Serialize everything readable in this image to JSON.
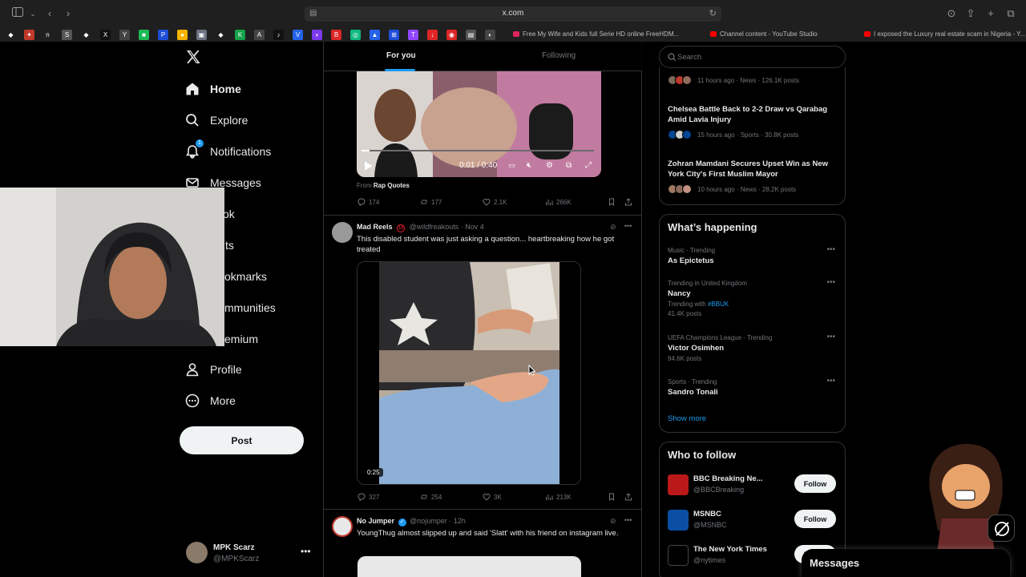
{
  "browser": {
    "url": "x.com",
    "tabs": [
      {
        "title": "Free My Wife and Kids full Serie HD online FreeHDM...",
        "color": "#e0245e"
      },
      {
        "title": "Channel content - YouTube Studio",
        "color": "#ff0000"
      },
      {
        "title": "I exposed the Luxury real estate scam in Nigeria - Y...",
        "color": "#ff0000"
      }
    ],
    "bookmark_icons": [
      {
        "glyph": "◆",
        "color": "#1f1f1f"
      },
      {
        "glyph": "✦",
        "color": "#c0392b"
      },
      {
        "glyph": "n",
        "color": "#1f1f1f"
      },
      {
        "glyph": "S",
        "color": "#555"
      },
      {
        "glyph": "◆",
        "color": "#1f1f1f"
      },
      {
        "glyph": "X",
        "color": "#111"
      },
      {
        "glyph": "Y",
        "color": "#444"
      },
      {
        "glyph": "■",
        "color": "#1db954"
      },
      {
        "glyph": "P",
        "color": "#1d4ed8"
      },
      {
        "glyph": "●",
        "color": "#f4b400"
      },
      {
        "glyph": "▣",
        "color": "#6b7280"
      },
      {
        "glyph": "◆",
        "color": "#1f1f1f"
      },
      {
        "glyph": "K",
        "color": "#16a34a"
      },
      {
        "glyph": "A",
        "color": "#444"
      },
      {
        "glyph": "♪",
        "color": "#111"
      },
      {
        "glyph": "V",
        "color": "#2563eb"
      },
      {
        "glyph": "◗",
        "color": "#7c3aed"
      },
      {
        "glyph": "B",
        "color": "#dc2626"
      },
      {
        "glyph": "◎",
        "color": "#10b981"
      },
      {
        "glyph": "▲",
        "color": "#2563eb"
      },
      {
        "glyph": "⊞",
        "color": "#1d4ed8"
      },
      {
        "glyph": "T",
        "color": "#9146ff"
      },
      {
        "glyph": "↓",
        "color": "#dc2626"
      },
      {
        "glyph": "◉",
        "color": "#dc2626"
      },
      {
        "glyph": "▤",
        "color": "#555"
      },
      {
        "glyph": "◐",
        "color": "#444"
      }
    ]
  },
  "nav": {
    "items": [
      {
        "label": "Home"
      },
      {
        "label": "Explore"
      },
      {
        "label": "Notifications",
        "badge": "1"
      },
      {
        "label": "Messages"
      },
      {
        "label": "ok"
      },
      {
        "label": "ts"
      },
      {
        "label": "okmarks"
      },
      {
        "label": "mmunities"
      },
      {
        "label": "emium"
      },
      {
        "label": "Profile"
      },
      {
        "label": "More"
      }
    ],
    "post_label": "Post",
    "account": {
      "name": "MPK Scarz",
      "handle": "@MPKScarz"
    }
  },
  "feed": {
    "tabs": [
      {
        "label": "For you"
      },
      {
        "label": "Following"
      }
    ],
    "video1": {
      "time": "0:01 / 0:40",
      "from_prefix": "From",
      "from_name": "Rap Quotes",
      "actions": {
        "replies": "174",
        "reposts": "177",
        "likes": "2.1K",
        "views": "266K"
      }
    },
    "tweet2": {
      "name": "Mad Reels",
      "age_badge": "18",
      "meta": "@wildfreakouts · Nov 4",
      "text": "This disabled student was just asking a question... heartbreaking how he got treated",
      "duration": "0:25",
      "actions": {
        "replies": "327",
        "reposts": "254",
        "likes": "3K",
        "views": "213K"
      }
    },
    "tweet3": {
      "name": "No Jumper",
      "meta": "@nojumper · 12h",
      "text": "YoungThug almost slipped up and said 'Slatt' with his friend on instagram live."
    }
  },
  "sidebar": {
    "search_placeholder": "Search",
    "news": [
      {
        "title": "",
        "meta": "11 hours ago · News · 126.1K posts"
      },
      {
        "title": "Chelsea Battle Back to 2-2 Draw vs Qarabag Amid Lavia Injury",
        "meta": "15 hours ago · Sports · 30.8K posts"
      },
      {
        "title": "Zohran Mamdani Secures Upset Win as New York City's First Muslim Mayor",
        "meta": "10 hours ago · News · 28.2K posts"
      }
    ],
    "whats_happening": {
      "title": "What’s happening",
      "trends": [
        {
          "context": "Music · Trending",
          "name": "As Epictetus",
          "sub": ""
        },
        {
          "context": "Trending in United Kingdom",
          "name": "Nancy",
          "sub_prefix": "Trending with",
          "sub_tag": "#BBUK",
          "posts": "41.4K posts"
        },
        {
          "context": "UEFA Champions League · Trending",
          "name": "Victor Osimhen",
          "posts": "94.6K posts"
        },
        {
          "context": "Sports · Trending",
          "name": "Sandro Tonali"
        }
      ],
      "show_more": "Show more"
    },
    "who_to_follow": {
      "title": "Who to follow",
      "accounts": [
        {
          "name": "BBC Breaking Ne...",
          "handle": "@BBCBreaking",
          "button": "Follow"
        },
        {
          "name": "MSNBC",
          "handle": "@MSNBC",
          "button": "Follow"
        },
        {
          "name": "The New York Times",
          "handle": "@nytimes",
          "button": "Follow"
        }
      ]
    },
    "messages_drawer": "Messages"
  }
}
